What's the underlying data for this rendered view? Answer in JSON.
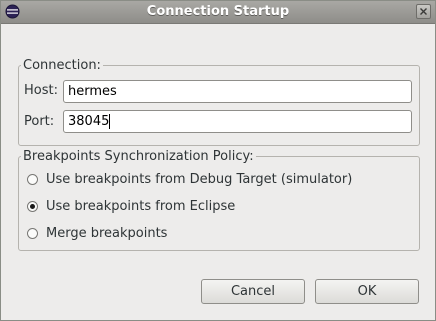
{
  "window": {
    "title": "Connection Startup"
  },
  "connection": {
    "legend": "Connection:",
    "host_label": "Host:",
    "host_value": "hermes",
    "port_label": "Port:",
    "port_value": "38045"
  },
  "breakpoints": {
    "legend": "Breakpoints Synchronization Policy:",
    "options": [
      {
        "label": "Use breakpoints from Debug Target (simulator)",
        "selected": false
      },
      {
        "label": "Use breakpoints from Eclipse",
        "selected": true
      },
      {
        "label": "Merge breakpoints",
        "selected": false
      }
    ]
  },
  "buttons": {
    "cancel_label": "Cancel",
    "ok_label": "OK"
  },
  "icons": {
    "app": "eclipse-icon",
    "close": "close-icon"
  },
  "colors": {
    "titlebar": "#9e9d99",
    "dialog_background": "#edeceb"
  }
}
